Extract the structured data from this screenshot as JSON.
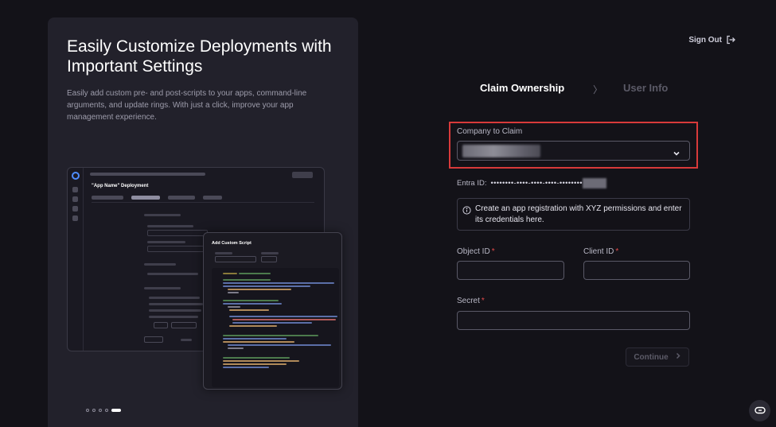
{
  "promo": {
    "title": "Easily Customize Deployments with Important Settings",
    "description": "Easily add custom pre- and post-scripts to your apps, command-line arguments, and update rings. With just a click, improve your app management experience.",
    "mock_screen": {
      "title": "\"App Name\" Deployment",
      "dialog_title": "Add Custom Script"
    },
    "carousel": {
      "count": 5,
      "active_index": 4
    }
  },
  "header": {
    "sign_out_label": "Sign Out",
    "sign_out_icon": "sign-out-icon"
  },
  "steps": [
    {
      "label": "Claim Ownership",
      "active": true
    },
    {
      "label": "User Info",
      "active": false
    }
  ],
  "step_separator": "〉",
  "form": {
    "company": {
      "label": "Company to Claim",
      "value_redacted": true,
      "icon": "chevron-down-icon"
    },
    "entra": {
      "label": "Entra ID:",
      "value": "••••••••-••••-••••-••••-••••••••"
    },
    "info": {
      "icon": "info-icon",
      "text": "Create an app registration with XYZ permissions and enter its credentials here."
    },
    "object_id": {
      "label": "Object ID",
      "required_mark": "*",
      "value": ""
    },
    "client_id": {
      "label": "Client ID",
      "required_mark": "*",
      "value": ""
    },
    "secret": {
      "label": "Secret",
      "required_mark": "*",
      "value": ""
    },
    "continue_label": "Continue",
    "continue_icon": "chevron-right-icon"
  },
  "support": {
    "icon": "chat-support-icon"
  },
  "colors": {
    "background": "#131218",
    "panel": "#22212b",
    "highlight_border": "#d83a3a",
    "required": "#e34b4b"
  }
}
